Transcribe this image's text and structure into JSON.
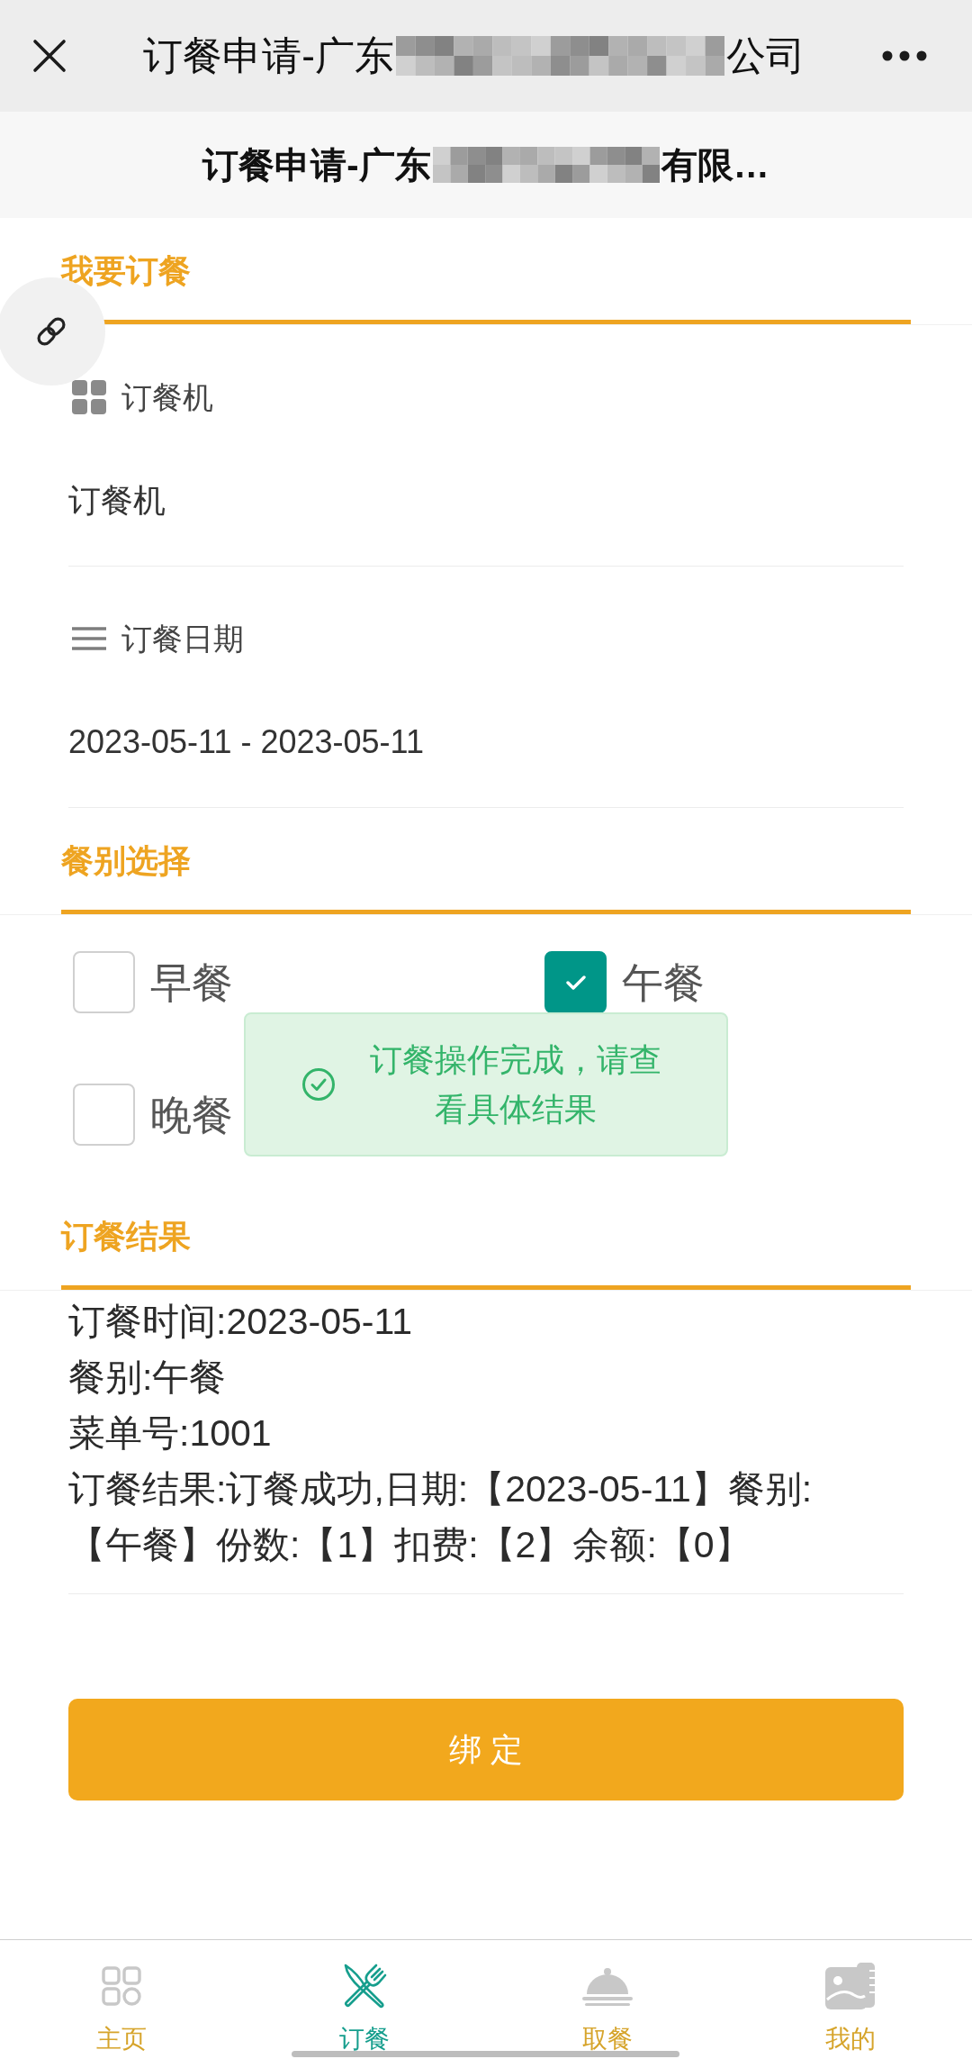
{
  "top_bar": {
    "title_start": "订餐申请-广东",
    "title_end": "公司"
  },
  "page_header": {
    "title_start": "订餐申请-广东",
    "title_end": "有限…"
  },
  "order_section": {
    "title": "我要订餐",
    "fields": [
      {
        "kind": "select",
        "label": "订餐机",
        "value": "订餐机"
      },
      {
        "kind": "date_range",
        "label": "订餐日期",
        "value": "2023-05-11 - 2023-05-11"
      }
    ]
  },
  "meal_section": {
    "title": "餐别选择",
    "options": [
      {
        "label": "早餐",
        "checked": false
      },
      {
        "label": "午餐",
        "checked": true
      },
      {
        "label": "晚餐",
        "checked": false
      }
    ]
  },
  "toast": {
    "message": "订餐操作完成，请查看具体结果"
  },
  "result_section": {
    "title": "订餐结果",
    "lines": [
      "订餐时间:2023-05-11",
      "餐别:午餐",
      "菜单号:1001",
      "订餐结果:订餐成功,日期:【2023-05-11】餐别:【午餐】份数:【1】扣费:【2】余额:【0】"
    ]
  },
  "bind_button": {
    "label": "绑 定"
  },
  "tab_bar": {
    "tabs": [
      {
        "label": "主页",
        "selected": false
      },
      {
        "label": "订餐",
        "selected": true
      },
      {
        "label": "取餐",
        "selected": false
      },
      {
        "label": "我的",
        "selected": false
      }
    ]
  }
}
